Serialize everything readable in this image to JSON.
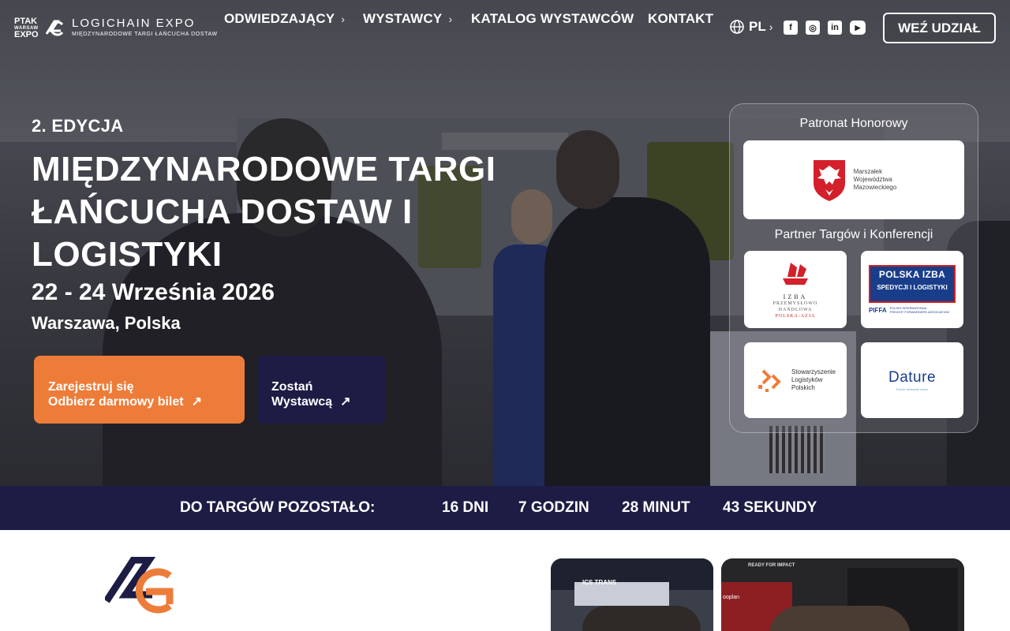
{
  "header": {
    "ptak_logo": {
      "line1": "PTAK",
      "line2": "WARSAW",
      "line3": "EXPO"
    },
    "brand_title": "LOGICHAIN EXPO",
    "brand_subtitle": "MIĘDZYNARODOWE TARGI ŁAŃCUCHA DOSTAW",
    "nav": [
      {
        "label": "ODWIEDZAJĄCY",
        "has_submenu": true
      },
      {
        "label": "WYSTAWCY",
        "has_submenu": true
      },
      {
        "label": "KATALOG WYSTAWCÓW",
        "has_submenu": false
      },
      {
        "label": "KONTAKT",
        "has_submenu": false
      }
    ],
    "language": "PL",
    "socials": [
      "facebook-icon",
      "instagram-icon",
      "linkedin-icon",
      "youtube-icon"
    ],
    "cta_label": "WEŹ UDZIAŁ"
  },
  "hero": {
    "edition": "2. EDYCJA",
    "title_line1": "MIĘDZYNARODOWE TARGI",
    "title_line2": "ŁAŃCUCHA DOSTAW I",
    "title_line3": "LOGISTYKI",
    "dates": "22 - 24 Września 2026",
    "location": "Warszawa, Polska",
    "register_line1": "Zarejestruj się",
    "register_line2": "Odbierz darmowy bilet",
    "exhibitor_line1": "Zostań",
    "exhibitor_line2": "Wystawcą"
  },
  "partners": {
    "honorary_heading": "Patronat Honorowy",
    "honorary": {
      "line1": "Marszałek",
      "line2": "Województwa",
      "line3": "Mazowieckiego"
    },
    "partners_heading": "Partner Targów i Konferencji",
    "izba": {
      "line1": "IZBA",
      "line2": "PRZEMYSŁOWO",
      "line3": "HANDLOWA",
      "line4": "POLSKA-AZJA"
    },
    "pifa": {
      "line1": "POLSKA IZBA",
      "line2": "SPEDYCJI I LOGISTYKI",
      "short": "PIFFA",
      "desc1": "POLISH INTERNATIONAL",
      "desc2": "FREIGHT FORWARDERS ASSOCIATION"
    },
    "slp": {
      "line1": "Stowarzyszenie",
      "line2": "Logistyków",
      "line3": "Polskich"
    },
    "dature": {
      "name": "Dature",
      "tagline": "Future demands vision"
    }
  },
  "countdown": {
    "label": "DO TARGÓW POZOSTAŁO:",
    "days": "16 DNI",
    "hours": "7 GODZIN",
    "minutes": "28 MINUT",
    "seconds": "43 SEKUNDY"
  },
  "photos": {
    "photo1_sign": "ICS TRANS",
    "photo2_sign": "READY FOR IMPACT",
    "photo2_brand": "ooplan"
  },
  "colors": {
    "accent_orange": "#ee7c39",
    "navy": "#1c1c44",
    "white": "#ffffff"
  }
}
